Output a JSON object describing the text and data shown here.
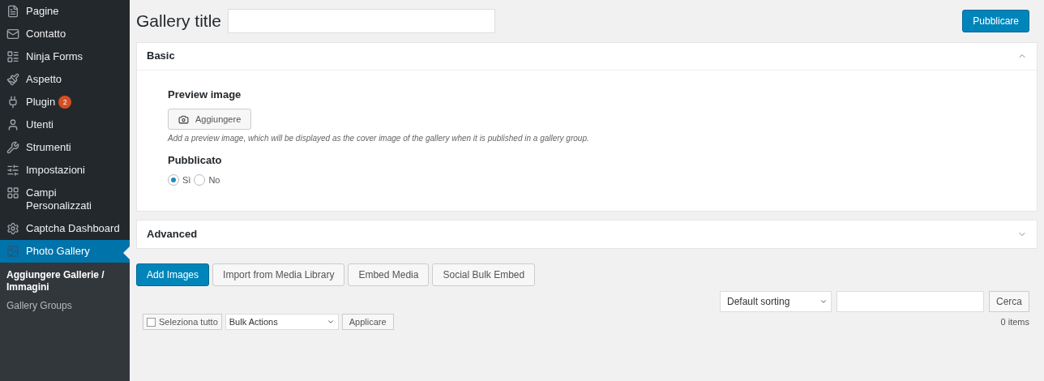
{
  "sidebar": {
    "items": [
      {
        "label": "Pagine",
        "selected": false
      },
      {
        "label": "Contatto",
        "selected": false
      },
      {
        "label": "Ninja Forms",
        "selected": false
      },
      {
        "label": "Aspetto",
        "selected": false
      },
      {
        "label": "Plugin",
        "selected": false,
        "badge": "2"
      },
      {
        "label": "Utenti",
        "selected": false
      },
      {
        "label": "Strumenti",
        "selected": false
      },
      {
        "label": "Impostazioni",
        "selected": false
      },
      {
        "label": "Campi Personalizzati",
        "selected": false
      },
      {
        "label": "Captcha Dashboard",
        "selected": false
      },
      {
        "label": "Photo Gallery",
        "selected": true
      }
    ],
    "submenu": [
      {
        "label": "Aggiungere Gallerie / Immagini",
        "selected": true
      },
      {
        "label": "Gallery Groups",
        "selected": false
      }
    ]
  },
  "title_field": {
    "label": "Gallery title"
  },
  "publish_button": "Pubblicare",
  "panels": [
    {
      "title": "Basic",
      "expanded": true
    },
    {
      "title": "Advanced",
      "expanded": false
    }
  ],
  "basic": {
    "preview_label": "Preview image",
    "add_button": "Aggiungere",
    "help": "Add a preview image, which will be displayed as the cover image of the gallery when it is published in a gallery group.",
    "published_label": "Pubblicato",
    "options": [
      {
        "label": "Sì",
        "selected": true
      },
      {
        "label": "No",
        "selected": false
      }
    ]
  },
  "media_buttons": [
    {
      "label": "Add Images",
      "primary": true
    },
    {
      "label": "Import from Media Library",
      "primary": false
    },
    {
      "label": "Embed Media",
      "primary": false
    },
    {
      "label": "Social Bulk Embed",
      "primary": false
    }
  ],
  "sorting": {
    "value": "Default sorting",
    "search_button": "Cerca"
  },
  "bulk": {
    "select_all": "Seleziona tutto",
    "checked": false,
    "action": "Bulk Actions",
    "apply": "Applicare",
    "count": "0 items"
  }
}
